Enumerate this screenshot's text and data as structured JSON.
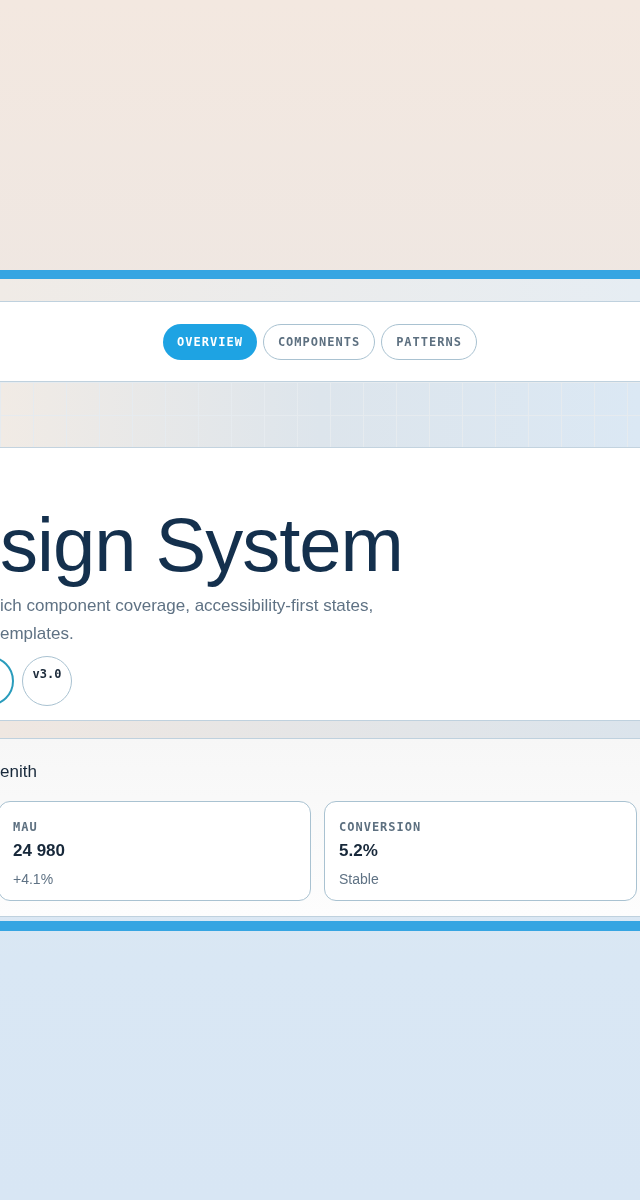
{
  "nav": {
    "tabs": [
      {
        "label": "OVERVIEW",
        "selected": true
      },
      {
        "label": "COMPONENTS",
        "selected": false
      },
      {
        "label": "PATTERNS",
        "selected": false
      }
    ]
  },
  "hero": {
    "title": "sign System",
    "description_lines": [
      "ich component coverage, accessibility-first states,",
      "emplates."
    ],
    "badges": [
      {
        "selected": true
      },
      {
        "label": "v3.0",
        "selected": false
      }
    ]
  },
  "stats": {
    "heading": "enith",
    "cards": [
      {
        "label": "MAU",
        "value": "24 980",
        "note": "+4.1%"
      },
      {
        "label": "CONVERSION",
        "value": "5.2%",
        "note": "Stable"
      }
    ]
  }
}
